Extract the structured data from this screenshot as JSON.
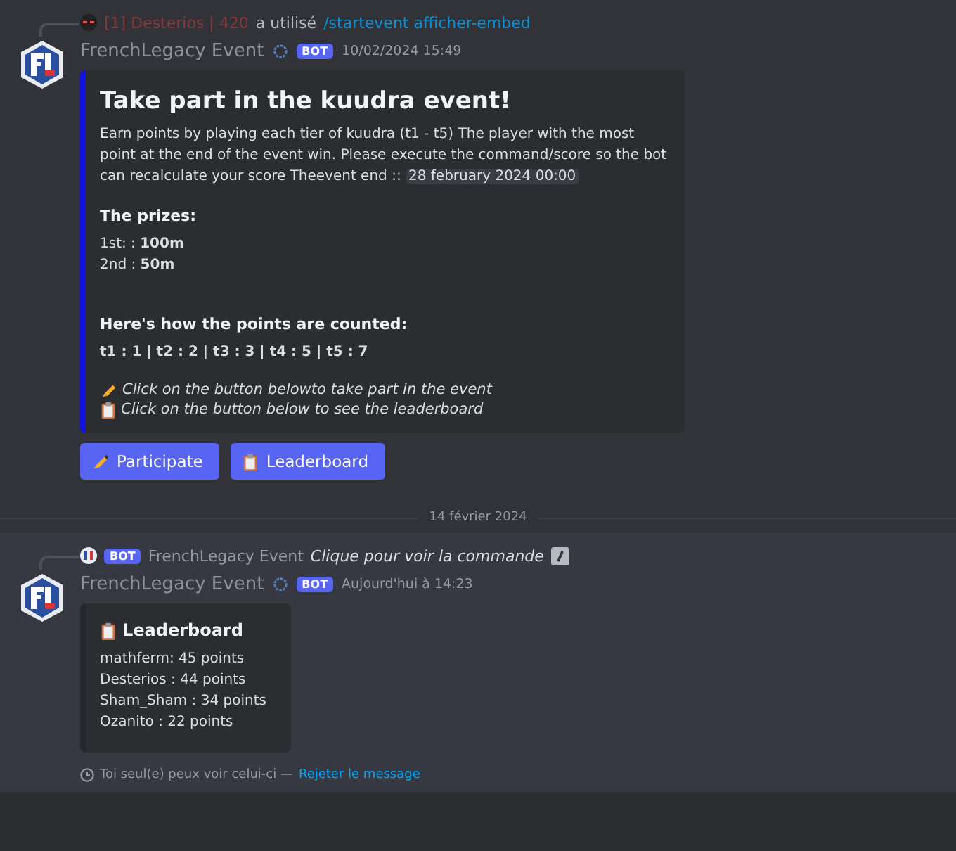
{
  "messages": [
    {
      "reply": {
        "user": "[1] Desterios | 420",
        "action": "a utilisé",
        "command": "/startevent afficher-embed"
      },
      "author": "FrenchLegacy Event",
      "badge": "BOT",
      "time": "10/02/2024 15:49",
      "embed": {
        "title": "Take part in the kuudra event!",
        "description": "Earn points by playing each tier of kuudra (t1 - t5) The player with the most point at the end of the event win. Please execute the command/score so the bot can recalculate your score Theevent end ::",
        "date": "28 february 2024 00:00",
        "sections": [
          {
            "heading": "The prizes:",
            "lines": [
              "1st: : **100m**",
              "2nd : **50m**"
            ],
            "bold": false
          },
          {
            "heading": "Here's how the points are counted:",
            "lines": [
              "t1 : 1 | t2 : 2 | t3 : 3 | t4 : 5 | t5 : 7"
            ],
            "bold": true
          }
        ],
        "notes": [
          "Click on the button belowto take part in the event",
          "Click on the button below to see the leaderboard"
        ]
      },
      "buttons": [
        "Participate",
        "Leaderboard"
      ]
    }
  ],
  "divider": "14 février 2024",
  "ephemeral": {
    "reply": {
      "badge": "BOT",
      "user": "FrenchLegacy Event",
      "command": "Clique pour voir la commande"
    },
    "author": "FrenchLegacy Event",
    "badge": "BOT",
    "time": "Aujourd'hui à 14:23",
    "embed": {
      "title": "Leaderboard",
      "lines": [
        "mathferm: 45 points",
        "Desterios : 44 points",
        "Sham_Sham : 34 points",
        "Ozanito : 22 points"
      ]
    },
    "footer": "Toi seul(e) peux voir celui-ci —",
    "dismiss": "Rejeter le message"
  }
}
